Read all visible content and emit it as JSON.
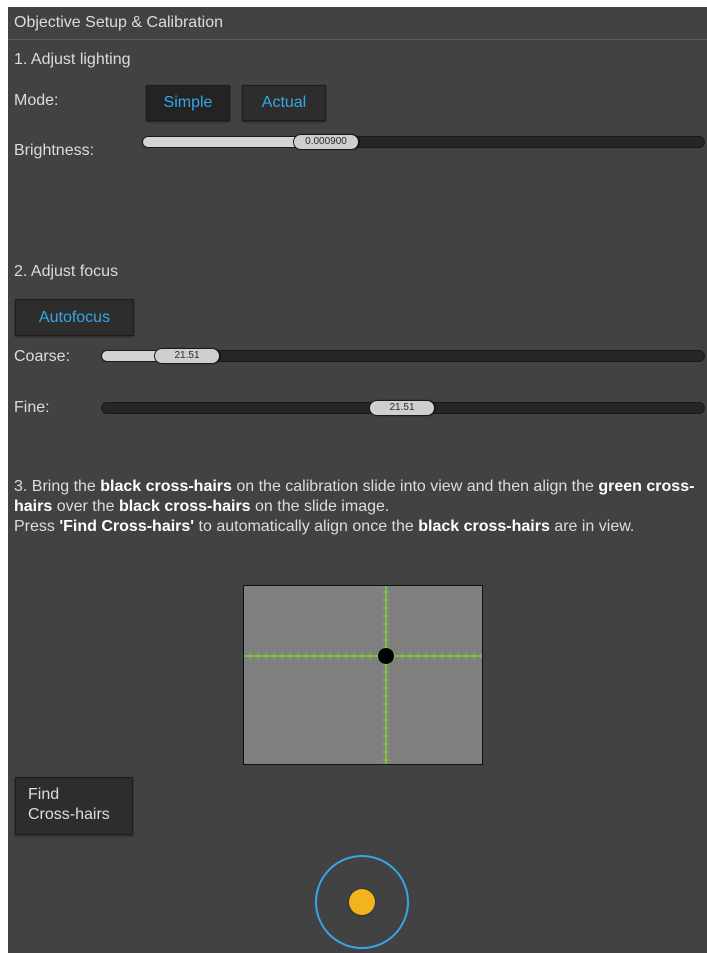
{
  "header": {
    "title": "Objective Setup & Calibration"
  },
  "lighting": {
    "section_title": "1. Adjust lighting",
    "mode_label": "Mode:",
    "mode_options": [
      "Simple",
      "Actual"
    ],
    "selected_mode": "Simple",
    "brightness_label": "Brightness:",
    "brightness_value": "0.000900"
  },
  "focus": {
    "section_title": "2. Adjust focus",
    "autofocus_label": "Autofocus",
    "coarse_label": "Coarse:",
    "coarse_value": "21.51",
    "fine_label": "Fine:",
    "fine_value": "21.51"
  },
  "crosshairs": {
    "instruction": [
      {
        "text": "3. Bring the ",
        "bold": false
      },
      {
        "text": "black cross-hairs",
        "bold": true
      },
      {
        "text": " on the calibration slide into view and then align the ",
        "bold": false
      },
      {
        "text": "green cross-hairs",
        "bold": true
      },
      {
        "text": " over the ",
        "bold": false
      },
      {
        "text": "black cross-hairs",
        "bold": true
      },
      {
        "text": " on the slide image.",
        "bold": false
      },
      {
        "text": "\n",
        "bold": false
      },
      {
        "text": "Press ",
        "bold": false
      },
      {
        "text": "'Find Cross-hairs'",
        "bold": true
      },
      {
        "text": " to automatically align once the ",
        "bold": false
      },
      {
        "text": "black cross-hairs",
        "bold": true
      },
      {
        "text": " are in view.",
        "bold": false
      }
    ],
    "find_button_line1": "Find",
    "find_button_line2": "Cross-hairs",
    "crosshair_color": "#7fd230",
    "target_color": "#000000"
  },
  "joystick": {
    "knob_color": "#f0b41c",
    "ring_color": "#35a7e6"
  }
}
